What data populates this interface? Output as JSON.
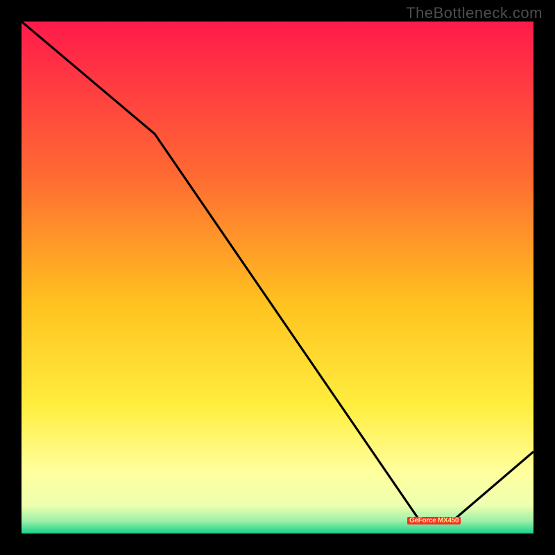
{
  "watermark": "TheBottleneck.com",
  "legend": {
    "gpu_label": "GeForce MX450"
  },
  "chart_data": {
    "type": "line",
    "title": "",
    "xlabel": "",
    "ylabel": "",
    "x_range": [
      0,
      100
    ],
    "y_range": [
      0,
      100
    ],
    "background_gradient": {
      "orientation": "vertical",
      "stops": [
        {
          "pos": 0.0,
          "color": "#ff1a4b"
        },
        {
          "pos": 0.3,
          "color": "#ff6a33"
        },
        {
          "pos": 0.55,
          "color": "#ffc21f"
        },
        {
          "pos": 0.75,
          "color": "#ffee3e"
        },
        {
          "pos": 0.88,
          "color": "#ffff9e"
        },
        {
          "pos": 0.945,
          "color": "#eeffb0"
        },
        {
          "pos": 0.975,
          "color": "#9ff0a8"
        },
        {
          "pos": 1.0,
          "color": "#17d28a"
        }
      ]
    },
    "series": [
      {
        "name": "bottleneck-curve",
        "points": [
          {
            "x": 0,
            "y": 100
          },
          {
            "x": 26,
            "y": 78
          },
          {
            "x": 78,
            "y": 2.3
          },
          {
            "x": 84,
            "y": 2.3
          },
          {
            "x": 100,
            "y": 16
          }
        ],
        "optimum_segment": {
          "x_start": 78,
          "x_end": 84,
          "y": 2.3
        }
      }
    ],
    "annotations": [
      {
        "id": "gpu-badge",
        "text": "GeForce MX450",
        "x": 81,
        "y": 2.3
      }
    ]
  }
}
